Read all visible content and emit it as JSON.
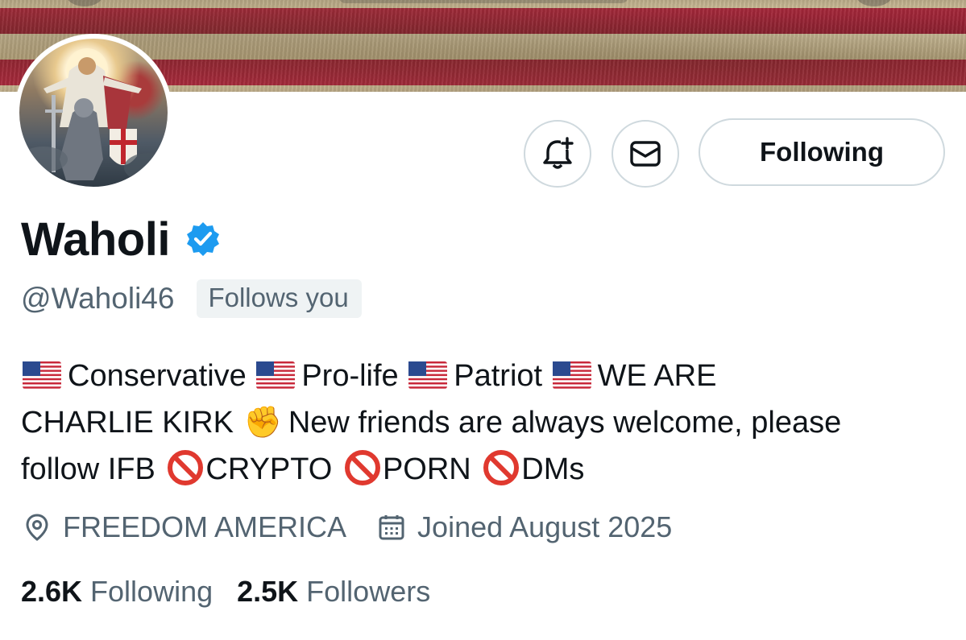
{
  "profile": {
    "display_name": "Waholi",
    "verified": true,
    "handle": "@Waholi46",
    "follows_you": "Follows you",
    "bio": {
      "seg1": "Conservative",
      "seg2": "Pro-life",
      "seg3": "Patriot",
      "seg4": "WE ARE",
      "seg5": "CHARLIE KIRK",
      "seg6": "New friends are always welcome, please",
      "seg7": "follow IFB",
      "seg8": "CRYPTO",
      "seg9": "PORN",
      "seg10": "DMs"
    },
    "location": "FREEDOM AMERICA",
    "joined": "Joined August 2025"
  },
  "actions": {
    "follow_label": "Following",
    "notify_icon": "bell-plus-icon",
    "message_icon": "envelope-icon"
  },
  "stats": {
    "following_count": "2.6K",
    "following_label": "Following",
    "followers_count": "2.5K",
    "followers_label": "Followers"
  },
  "colors": {
    "verified": "#1d9bf0",
    "secondary_text": "#536471",
    "primary_text": "#0f1419",
    "button_border": "#cfd9de",
    "badge_bg": "#eff3f4",
    "no_entry": "#e0392f"
  }
}
